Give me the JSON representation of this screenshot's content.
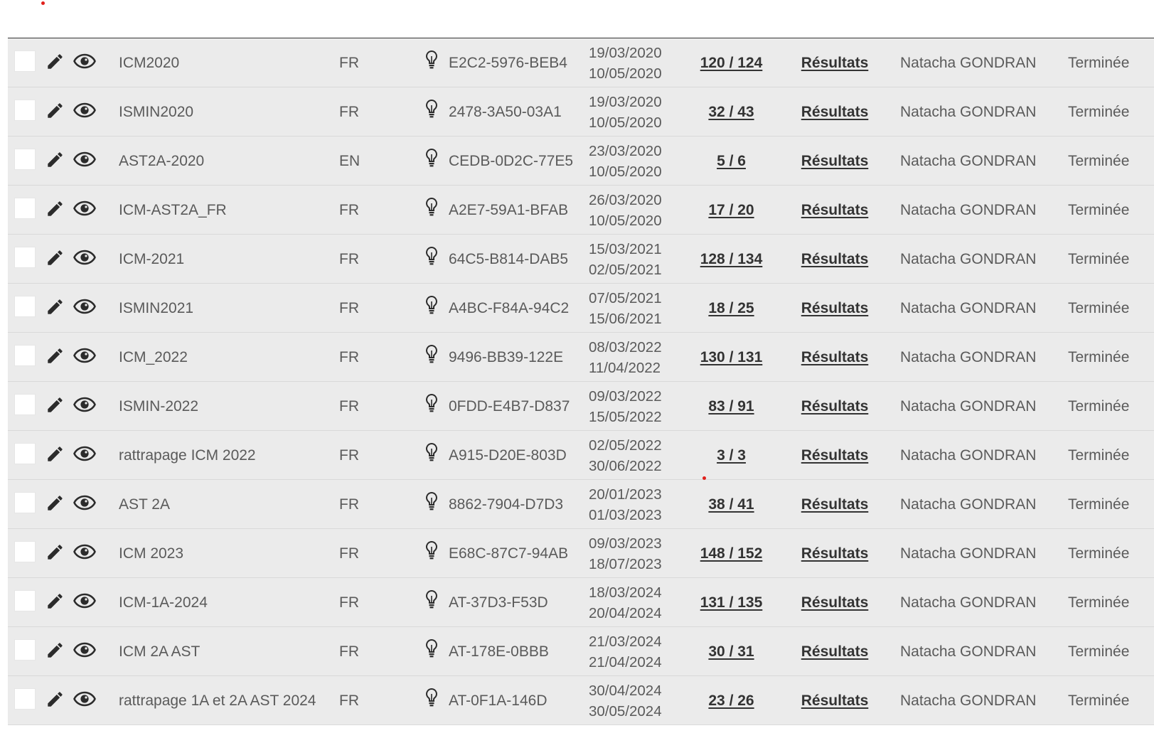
{
  "rows": [
    {
      "name": "ICM2020",
      "lang": "FR",
      "code": "E2C2-5976-BEB4",
      "start": "19/03/2020",
      "end": "10/05/2020",
      "count": "120 / 124",
      "results": "Résultats",
      "owner": "Natacha GONDRAN",
      "status": "Terminée"
    },
    {
      "name": "ISMIN2020",
      "lang": "FR",
      "code": "2478-3A50-03A1",
      "start": "19/03/2020",
      "end": "10/05/2020",
      "count": "32 / 43",
      "results": "Résultats",
      "owner": "Natacha GONDRAN",
      "status": "Terminée"
    },
    {
      "name": "AST2A-2020",
      "lang": "EN",
      "code": "CEDB-0D2C-77E5",
      "start": "23/03/2020",
      "end": "10/05/2020",
      "count": "5 / 6",
      "results": "Résultats",
      "owner": "Natacha GONDRAN",
      "status": "Terminée"
    },
    {
      "name": "ICM-AST2A_FR",
      "lang": "FR",
      "code": "A2E7-59A1-BFAB",
      "start": "26/03/2020",
      "end": "10/05/2020",
      "count": "17 / 20",
      "results": "Résultats",
      "owner": "Natacha GONDRAN",
      "status": "Terminée"
    },
    {
      "name": "ICM-2021",
      "lang": "FR",
      "code": "64C5-B814-DAB5",
      "start": "15/03/2021",
      "end": "02/05/2021",
      "count": "128 / 134",
      "results": "Résultats",
      "owner": "Natacha GONDRAN",
      "status": "Terminée"
    },
    {
      "name": "ISMIN2021",
      "lang": "FR",
      "code": "A4BC-F84A-94C2",
      "start": "07/05/2021",
      "end": "15/06/2021",
      "count": "18 / 25",
      "results": "Résultats",
      "owner": "Natacha GONDRAN",
      "status": "Terminée"
    },
    {
      "name": "ICM_2022",
      "lang": "FR",
      "code": "9496-BB39-122E",
      "start": "08/03/2022",
      "end": "11/04/2022",
      "count": "130 / 131",
      "results": "Résultats",
      "owner": "Natacha GONDRAN",
      "status": "Terminée"
    },
    {
      "name": "ISMIN-2022",
      "lang": "FR",
      "code": "0FDD-E4B7-D837",
      "start": "09/03/2022",
      "end": "15/05/2022",
      "count": "83 / 91",
      "results": "Résultats",
      "owner": "Natacha GONDRAN",
      "status": "Terminée"
    },
    {
      "name": "rattrapage ICM 2022",
      "lang": "FR",
      "code": "A915-D20E-803D",
      "start": "02/05/2022",
      "end": "30/06/2022",
      "count": "3 / 3",
      "results": "Résultats",
      "owner": "Natacha GONDRAN",
      "status": "Terminée"
    },
    {
      "name": "AST 2A",
      "lang": "FR",
      "code": "8862-7904-D7D3",
      "start": "20/01/2023",
      "end": "01/03/2023",
      "count": "38 / 41",
      "results": "Résultats",
      "owner": "Natacha GONDRAN",
      "status": "Terminée"
    },
    {
      "name": "ICM 2023",
      "lang": "FR",
      "code": "E68C-87C7-94AB",
      "start": "09/03/2023",
      "end": "18/07/2023",
      "count": "148 / 152",
      "results": "Résultats",
      "owner": "Natacha GONDRAN",
      "status": "Terminée"
    },
    {
      "name": "ICM-1A-2024",
      "lang": "FR",
      "code": "AT-37D3-F53D",
      "start": "18/03/2024",
      "end": "20/04/2024",
      "count": "131 / 135",
      "results": "Résultats",
      "owner": "Natacha GONDRAN",
      "status": "Terminée"
    },
    {
      "name": "ICM 2A AST",
      "lang": "FR",
      "code": "AT-178E-0BBB",
      "start": "21/03/2024",
      "end": "21/04/2024",
      "count": "30 / 31",
      "results": "Résultats",
      "owner": "Natacha GONDRAN",
      "status": "Terminée"
    },
    {
      "name": "rattrapage 1A et 2A AST 2024",
      "lang": "FR",
      "code": "AT-0F1A-146D",
      "start": "30/04/2024",
      "end": "30/05/2024",
      "count": "23 / 26",
      "results": "Résultats",
      "owner": "Natacha GONDRAN",
      "status": "Terminée"
    }
  ],
  "icons": {
    "edit": "pencil-icon",
    "view": "eye-icon",
    "code": "lightbulb-icon"
  },
  "colors": {
    "row_background": "#ebebeb",
    "row_divider": "#d9d9d9",
    "header_rule": "#333333",
    "text": "#5a5a5a",
    "link": "#333333",
    "marker": "#e0201b"
  }
}
